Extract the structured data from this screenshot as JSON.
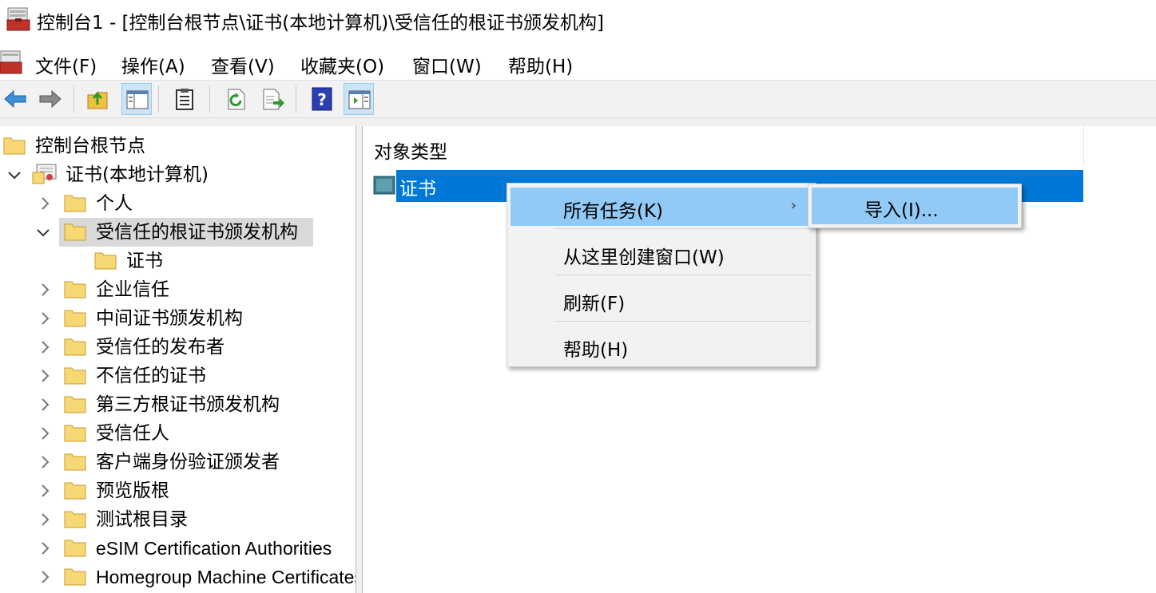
{
  "window": {
    "title": "控制台1 - [控制台根节点\\证书(本地计算机)\\受信任的根证书颁发机构]"
  },
  "menubar": {
    "items": [
      "文件(F)",
      "操作(A)",
      "查看(V)",
      "收藏夹(O)",
      "窗口(W)",
      "帮助(H)"
    ]
  },
  "toolbar": {
    "buttons": [
      "back-arrow-icon",
      "forward-arrow-icon",
      "up-folder-icon",
      "show-hide-tree-icon",
      "properties-icon",
      "refresh-icon",
      "export-list-icon",
      "help-icon",
      "show-action-pane-icon"
    ]
  },
  "tree": {
    "root": "控制台根节点",
    "certificates": "证书(本地计算机)",
    "items": {
      "personal": "个人",
      "trusted_root": "受信任的根证书颁发机构",
      "trusted_root_certs": "证书",
      "enterprise_trust": "企业信任",
      "intermediate": "中间证书颁发机构",
      "trusted_publishers": "受信任的发布者",
      "untrusted": "不信任的证书",
      "third_party_root": "第三方根证书颁发机构",
      "trusted_people": "受信任人",
      "client_auth_issuers": "客户端身份验证颁发者",
      "preview_build_roots": "预览版根",
      "test_roots": "测试根目录",
      "esim": "eSIM Certification Authorities",
      "homegroup": "Homegroup Machine Certificates"
    }
  },
  "result": {
    "column_header": "对象类型",
    "row_label": "证书"
  },
  "context_menu": {
    "all_tasks": "所有任务(K)",
    "all_tasks_arrow": "›",
    "new_window": "从这里创建窗口(W)",
    "refresh": "刷新(F)",
    "help": "帮助(H)"
  },
  "submenu": {
    "import": "导入(I)..."
  },
  "colors": {
    "selection_blue": "#0078d7",
    "menu_hover": "#91c9f7",
    "folder_yellow": "#f8d775"
  }
}
